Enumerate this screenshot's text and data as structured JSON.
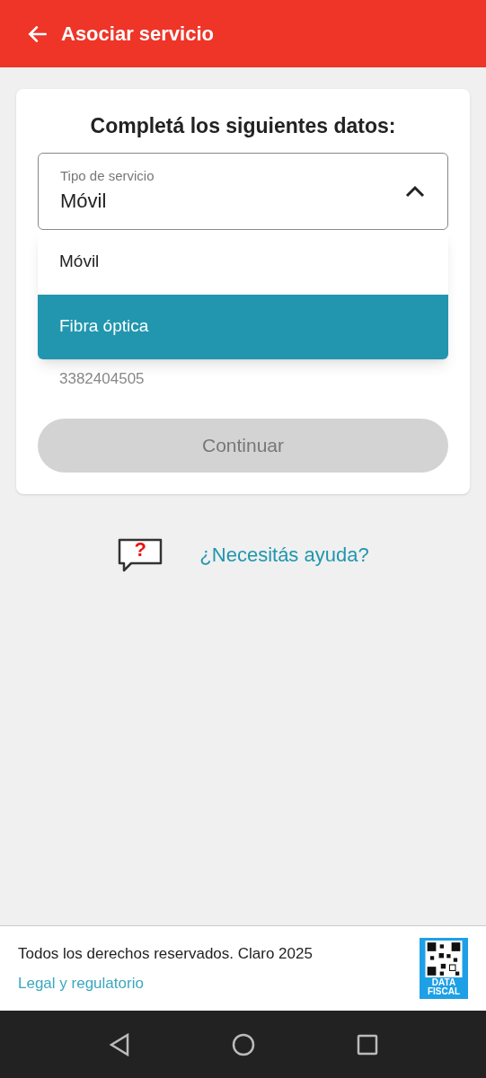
{
  "header": {
    "title": "Asociar servicio"
  },
  "form": {
    "heading": "Completá los siguientes datos:",
    "select": {
      "label": "Tipo de servicio",
      "value": "Móvil",
      "expanded": true
    },
    "options": [
      {
        "label": "Móvil",
        "selected": false
      },
      {
        "label": "Fibra óptica",
        "selected": true
      }
    ],
    "hint": "3382404505",
    "button": {
      "label": "Continuar",
      "disabled": true
    }
  },
  "help": {
    "label": "¿Necesitás ayuda?",
    "icon_text": "?"
  },
  "footer": {
    "copyright": "Todos los derechos reservados. Claro 2025",
    "link": "Legal y regulatorio",
    "badge": "DATA FISCAL"
  }
}
